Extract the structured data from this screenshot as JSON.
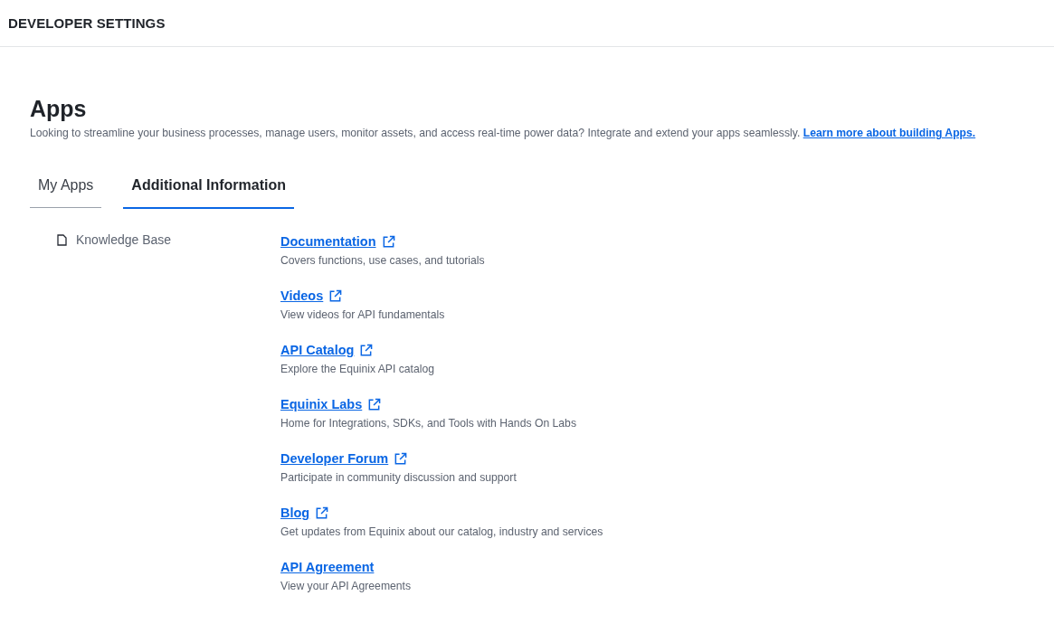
{
  "header": {
    "title": "DEVELOPER SETTINGS"
  },
  "page": {
    "title": "Apps",
    "description": "Looking to streamline your business processes, manage users, monitor assets, and access real-time power data? Integrate and extend your apps seamlessly.",
    "description_link": "Learn more about building Apps."
  },
  "tabs": [
    {
      "label": "My Apps",
      "selected": false
    },
    {
      "label": "Additional Information",
      "selected": true
    }
  ],
  "sidebar": {
    "items": [
      {
        "label": "Knowledge Base",
        "selected": true
      }
    ]
  },
  "resources": [
    {
      "title": "Documentation",
      "external": true,
      "description": "Covers functions, use cases, and tutorials"
    },
    {
      "title": "Videos",
      "external": true,
      "description": "View videos for API fundamentals"
    },
    {
      "title": "API Catalog",
      "external": true,
      "description": "Explore the Equinix API catalog"
    },
    {
      "title": "Equinix Labs",
      "external": true,
      "description": "Home for Integrations, SDKs, and Tools with Hands On Labs"
    },
    {
      "title": "Developer Forum",
      "external": true,
      "description": "Participate in community discussion and support"
    },
    {
      "title": "Blog",
      "external": true,
      "description": "Get updates from Equinix about our catalog, industry and services"
    },
    {
      "title": "API Agreement",
      "external": false,
      "description": "View your API Agreements"
    }
  ]
}
